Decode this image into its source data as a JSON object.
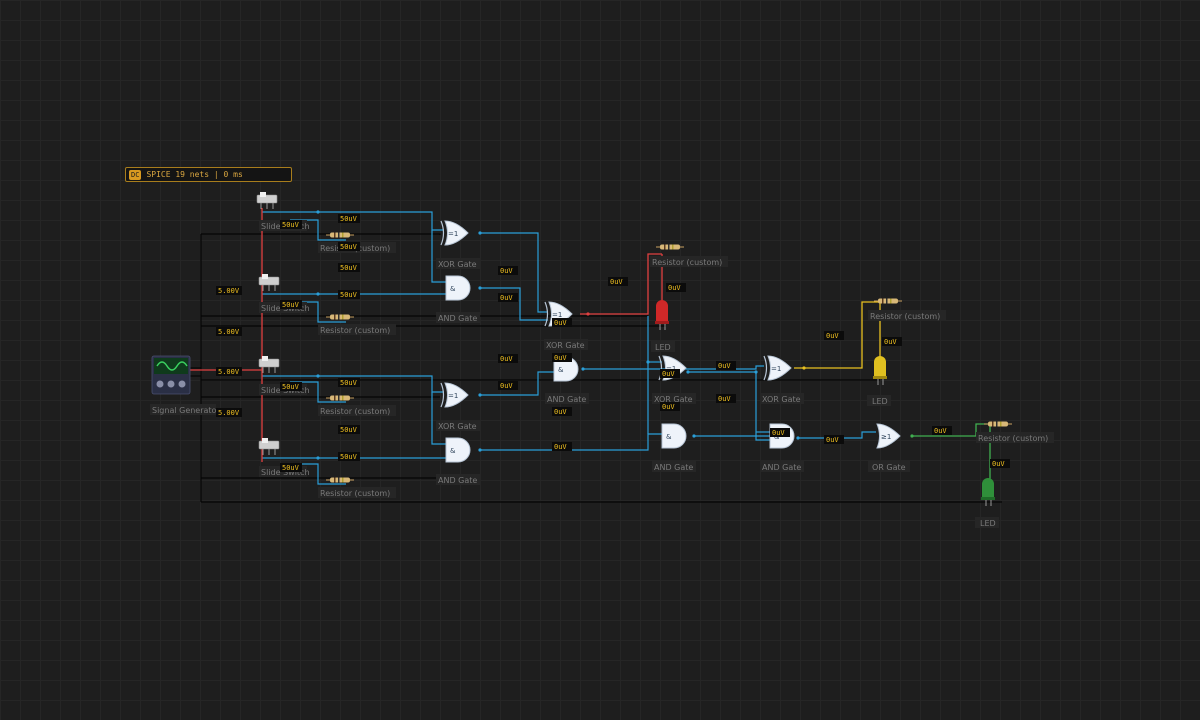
{
  "status": {
    "badge": "DC",
    "text": "SPICE 19 nets | 0 ms"
  },
  "labels": {
    "slide_switch": "Slide Switch",
    "resistor": "Resistor (custom)",
    "xor": "XOR Gate",
    "and": "AND Gate",
    "or": "OR Gate",
    "led": "LED",
    "signal": "Signal Generator"
  },
  "gate_symbols": {
    "xor": "=1",
    "and": "&",
    "or": "≥1"
  },
  "volt": {
    "zero": "0uV",
    "fifty": "50uV",
    "five": "5.00V"
  },
  "colors": {
    "wire_blue": "#2a9ed8",
    "wire_red": "#e04040",
    "wire_yellow": "#e8c020",
    "wire_green": "#40b050",
    "wire_dark": "#050505",
    "voltage_text": "#f0c020"
  }
}
